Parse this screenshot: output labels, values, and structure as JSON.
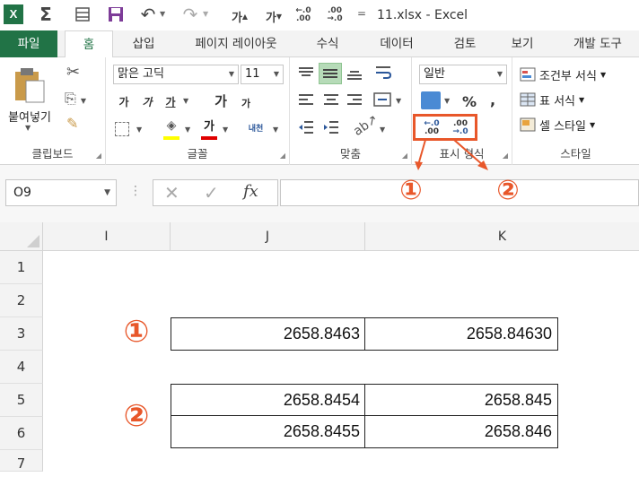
{
  "window": {
    "title": "11.xlsx - Excel"
  },
  "qat": {
    "excel_glyph": "X",
    "autosum_glyph": "Σ",
    "undo_glyph": "↶",
    "redo_glyph": "↷",
    "font_up_glyph": "가",
    "font_down_glyph": "가",
    "inc_dec_glyph": "←.0",
    "dec_dec_glyph": ".00",
    "more_glyph": "="
  },
  "tabs": [
    "파일",
    "홈",
    "삽입",
    "페이지 레이아웃",
    "수식",
    "데이터",
    "검토",
    "보기",
    "개발 도구"
  ],
  "ribbon": {
    "clipboard": {
      "paste_label": "붙여넣기",
      "group_label": "클립보드"
    },
    "font": {
      "font_name": "맑은 고딕",
      "font_size": "11",
      "bold": "가",
      "italic": "가",
      "underline": "가",
      "grow": "가",
      "shrink": "가",
      "phonetic": "내천",
      "font_color_glyph": "가",
      "group_label": "글꼴"
    },
    "alignment": {
      "group_label": "맞춤"
    },
    "number": {
      "format": "일반",
      "percent": "%",
      "comma": ",",
      "inc_decimal_top": "←.0",
      "inc_decimal_bottom": ".00",
      "dec_decimal_top": ".00",
      "dec_decimal_bottom": "→.0",
      "group_label": "표시 형식"
    },
    "styles": {
      "conditional": "조건부 서식",
      "table": "표 서식",
      "cell": "셀 스타일",
      "group_label": "스타일"
    }
  },
  "formula_bar": {
    "name_box": "O9",
    "fx": "fx",
    "cancel": "✕",
    "enter": "✓",
    "formula": ""
  },
  "columns": [
    "I",
    "J",
    "K"
  ],
  "rows": [
    "1",
    "2",
    "3",
    "4",
    "5",
    "6",
    "7"
  ],
  "cells": {
    "J3": "2658.8463",
    "K3": "2658.84630",
    "J5": "2658.8454",
    "K5": "2658.845",
    "J6": "2658.8455",
    "K6": "2658.846"
  },
  "annotations": {
    "one": "①",
    "two": "②",
    "accent_color": "#e8572a"
  },
  "colors": {
    "excel_green": "#217346",
    "header_bg": "#f3f3f3",
    "selected_align": "#b6dbb8"
  }
}
